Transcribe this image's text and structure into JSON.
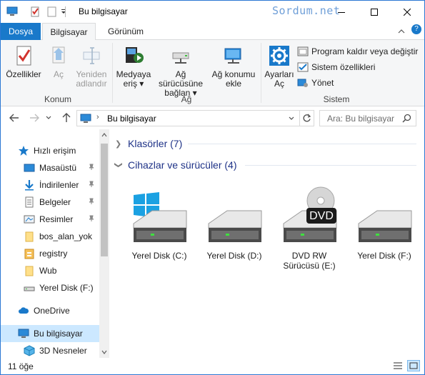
{
  "window": {
    "title": "Bu bilgisayar",
    "watermark": "Sordum.net"
  },
  "ribbon_tabs": [
    {
      "label": "Dosya"
    },
    {
      "label": "Bilgisayar"
    },
    {
      "label": "Görünüm"
    }
  ],
  "ribbon": {
    "konum": {
      "label": "Konum",
      "buttons": [
        {
          "line1": "Özellikler",
          "line2": ""
        },
        {
          "line1": "Aç",
          "line2": ""
        },
        {
          "line1": "Yeniden",
          "line2": "adlandır"
        }
      ]
    },
    "ag": {
      "label": "Ağ",
      "buttons": [
        {
          "line1": "Medyaya",
          "line2": "eriş ▾"
        },
        {
          "line1": "Ağ sürücüsüne",
          "line2": "bağlan ▾"
        },
        {
          "line1": "Ağ konumu",
          "line2": "ekle"
        }
      ]
    },
    "sistem": {
      "label": "Sistem",
      "settings": {
        "line1": "Ayarları",
        "line2": "Aç"
      },
      "items": [
        {
          "label": "Program kaldır veya değiştir"
        },
        {
          "label": "Sistem özellikleri"
        },
        {
          "label": "Yönet"
        }
      ]
    }
  },
  "address": {
    "path": "Bu bilgisayar",
    "search_placeholder": "Ara: Bu bilgisayar"
  },
  "nav_pane": {
    "quick_access": "Hızlı erişim",
    "items": [
      {
        "label": "Masaüstü",
        "pinned": true
      },
      {
        "label": "İndirilenler",
        "pinned": true
      },
      {
        "label": "Belgeler",
        "pinned": true
      },
      {
        "label": "Resimler",
        "pinned": true
      },
      {
        "label": "bos_alan_yok",
        "pinned": false
      },
      {
        "label": "registry",
        "pinned": false
      },
      {
        "label": "Wub",
        "pinned": false
      },
      {
        "label": "Yerel Disk (F:)",
        "pinned": false
      }
    ],
    "onedrive": "OneDrive",
    "this_pc": "Bu bilgisayar",
    "objects3d": "3D Nesneler"
  },
  "content": {
    "folders_group": "Klasörler (7)",
    "devices_group": "Cihazlar ve sürücüler (4)",
    "drives": [
      {
        "line1": "Yerel Disk (C:)",
        "line2": "",
        "icon": "windows-drive-icon"
      },
      {
        "line1": "Yerel Disk (D:)",
        "line2": "",
        "icon": "hard-drive-icon"
      },
      {
        "line1": "DVD RW",
        "line2": "Sürücüsü (E:)",
        "icon": "dvd-drive-icon"
      },
      {
        "line1": "Yerel Disk (F:)",
        "line2": "",
        "icon": "hard-drive-icon"
      }
    ],
    "dvd_label": "DVD"
  },
  "status": {
    "item_count": "11 öğe"
  },
  "colors": {
    "accent": "#1979ca",
    "header_blue": "#1e3287",
    "selection": "#cce8ff"
  }
}
